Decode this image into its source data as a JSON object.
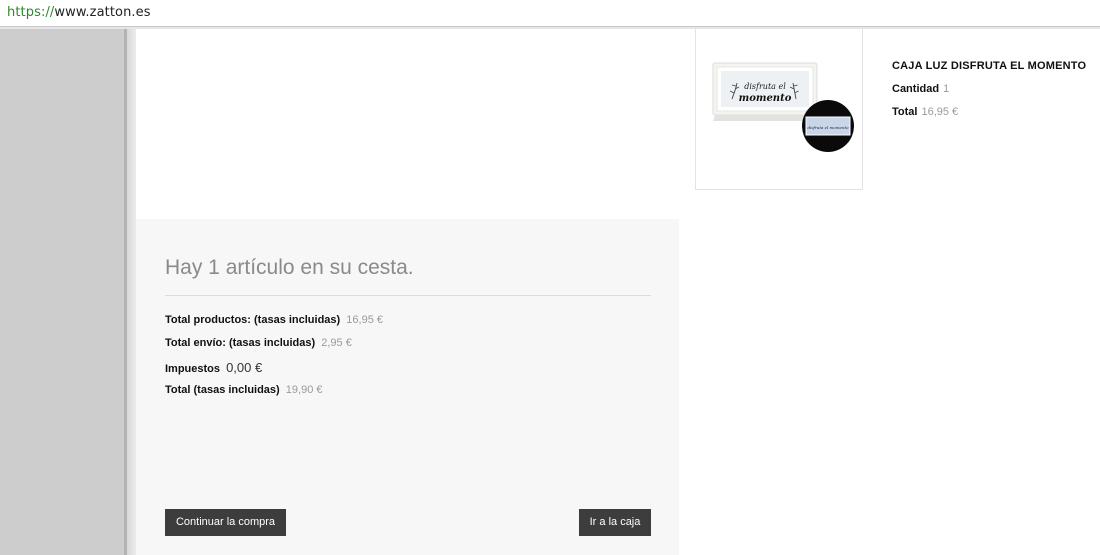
{
  "browser": {
    "url_scheme": "https://",
    "url_host": "www.zatton.es"
  },
  "cart": {
    "title": "Hay 1 artículo en su cesta.",
    "rows": [
      {
        "label": "Total productos: (tasas incluidas)",
        "value": "16,95 €"
      },
      {
        "label": "Total envío: (tasas incluidas)",
        "value": "2,95 €"
      },
      {
        "label": "Impuestos",
        "value": "0,00 €"
      },
      {
        "label": "Total (tasas incluidas)",
        "value": "19,90 €"
      }
    ],
    "continue_label": "Continuar la compra",
    "checkout_label": "Ir a la caja"
  },
  "product": {
    "name": "CAJA LUZ DISFRUTA EL MOMENTO",
    "quantity_label": "Cantidad",
    "quantity_value": "1",
    "total_label": "Total",
    "total_value": "16,95 €",
    "image_text_line1": "disfruta el",
    "image_text_line2": "momento",
    "image_text_zoom": "disfruta el momento"
  }
}
